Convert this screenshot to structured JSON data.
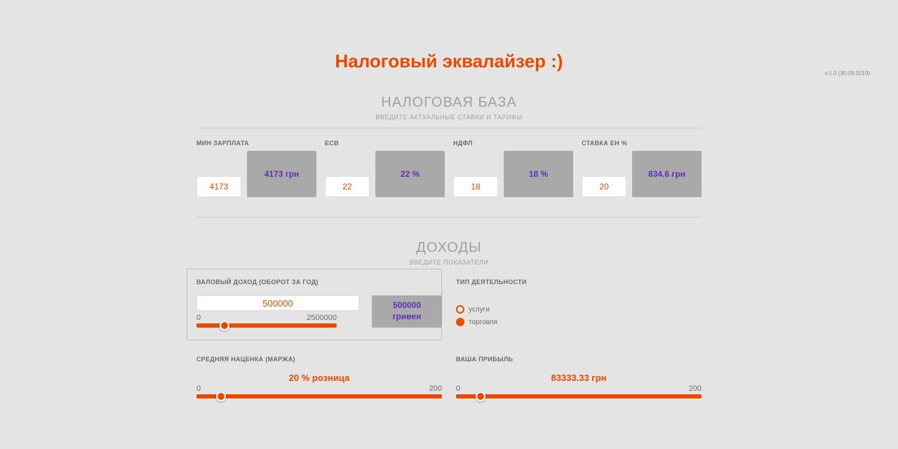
{
  "header": {
    "title": "Налоговый эквалайзер :)",
    "version": "v.1.0 (30.09.2019)"
  },
  "taxbase": {
    "title": "НАЛОГОВАЯ БАЗА",
    "subtitle": "ВВЕДИТЕ АКТУАЛЬНЫЕ СТАВКИ И ТАРИФЫ",
    "min_salary": {
      "label": "МИН ЗАРПЛАТА",
      "input": "4173",
      "display": "4173 грн"
    },
    "esw": {
      "label": "ЕСВ",
      "input": "22",
      "display": "22 %"
    },
    "ndfl": {
      "label": "НДФЛ",
      "input": "18",
      "display": "18 %"
    },
    "flat_tax": {
      "label": "СТАВКА ЕН %",
      "input": "20",
      "display": "834.6 грн"
    }
  },
  "income": {
    "title": "ДОХОДЫ",
    "subtitle": "ВВЕДИТЕ ПОКАЗАТЕЛИ",
    "gross": {
      "label": "ВАЛОВЫЙ ДОХОД (ОБОРОТ ЗА ГОД)",
      "input": "500000",
      "display_value": "500000",
      "display_unit": "гривен",
      "slider_min": "0",
      "slider_max": "2500000",
      "slider_pct": 20
    },
    "activity": {
      "label": "ТИП ДЕЯТЕЛЬНОСТИ",
      "options": [
        {
          "label": "услуги",
          "checked": false
        },
        {
          "label": "торговля",
          "checked": true
        }
      ]
    },
    "margin": {
      "label": "СРЕДНЯЯ НАЦЕНКА (МАРЖА)",
      "value": "20 % розница",
      "slider_min": "0",
      "slider_max": "200",
      "slider_pct": 10
    },
    "profit": {
      "label": "ВАША ПРИБЫЛЬ",
      "value": "83333.33 грн",
      "slider_min": "0",
      "slider_max": "200",
      "slider_pct": 10
    }
  }
}
